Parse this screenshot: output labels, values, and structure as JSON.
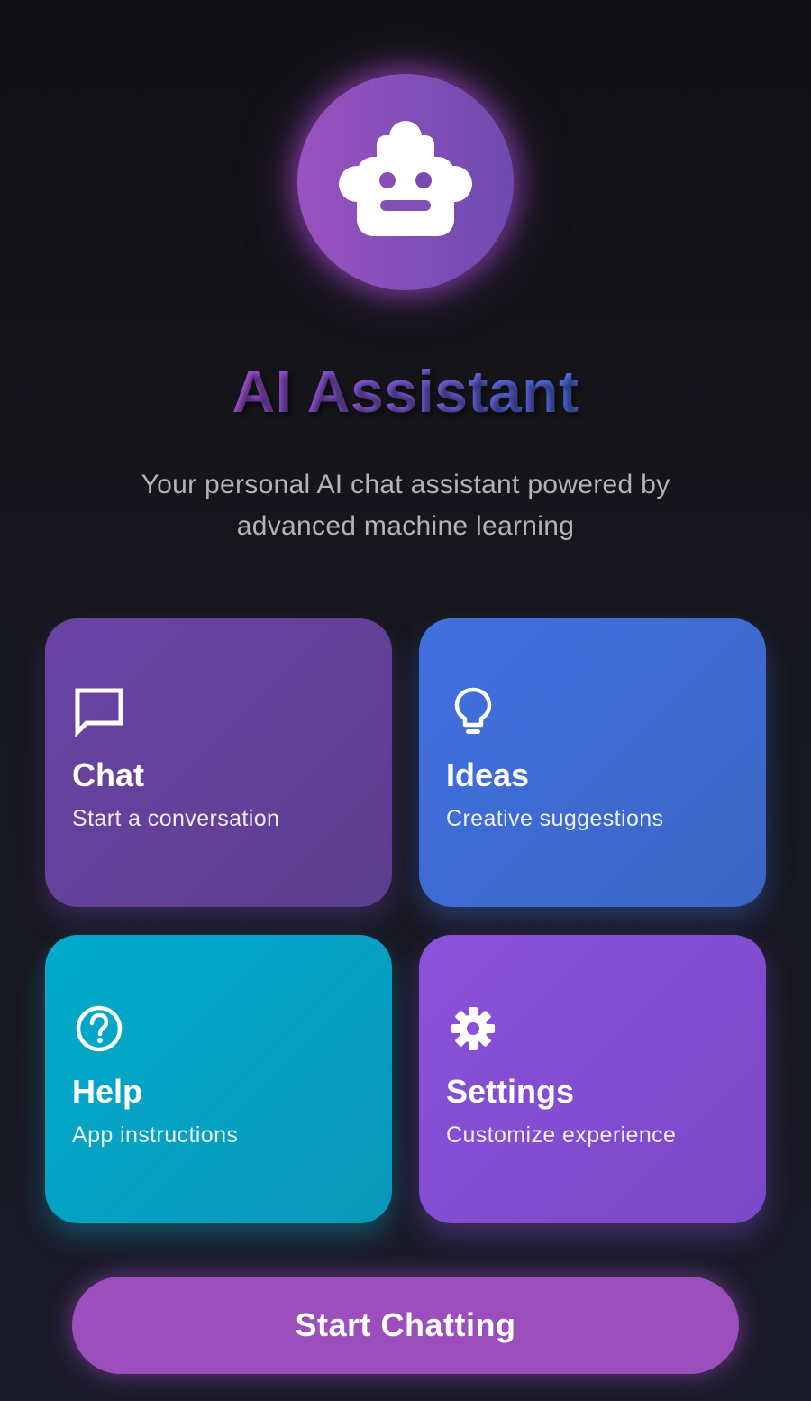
{
  "app": {
    "title": "AI Assistant",
    "subtitle": "Your personal AI chat assistant powered by advanced machine learning",
    "logo_icon": "robot-icon"
  },
  "cards": [
    {
      "title": "Chat",
      "subtitle": "Start a conversation",
      "icon": "chat-bubble-icon",
      "color": "#6a44a6"
    },
    {
      "title": "Ideas",
      "subtitle": "Creative suggestions",
      "icon": "lightbulb-icon",
      "color": "#4170df"
    },
    {
      "title": "Help",
      "subtitle": "App instructions",
      "icon": "help-circle-icon",
      "color": "#00abcc"
    },
    {
      "title": "Settings",
      "subtitle": "Customize experience",
      "icon": "gear-icon",
      "color": "#8a52da"
    }
  ],
  "actions": {
    "start_label": "Start Chatting"
  },
  "colors": {
    "accent": "#9c4fbc",
    "background": "#121214",
    "title_gradient_start": "#9a4ed1",
    "title_gradient_end": "#4a6ee0"
  }
}
